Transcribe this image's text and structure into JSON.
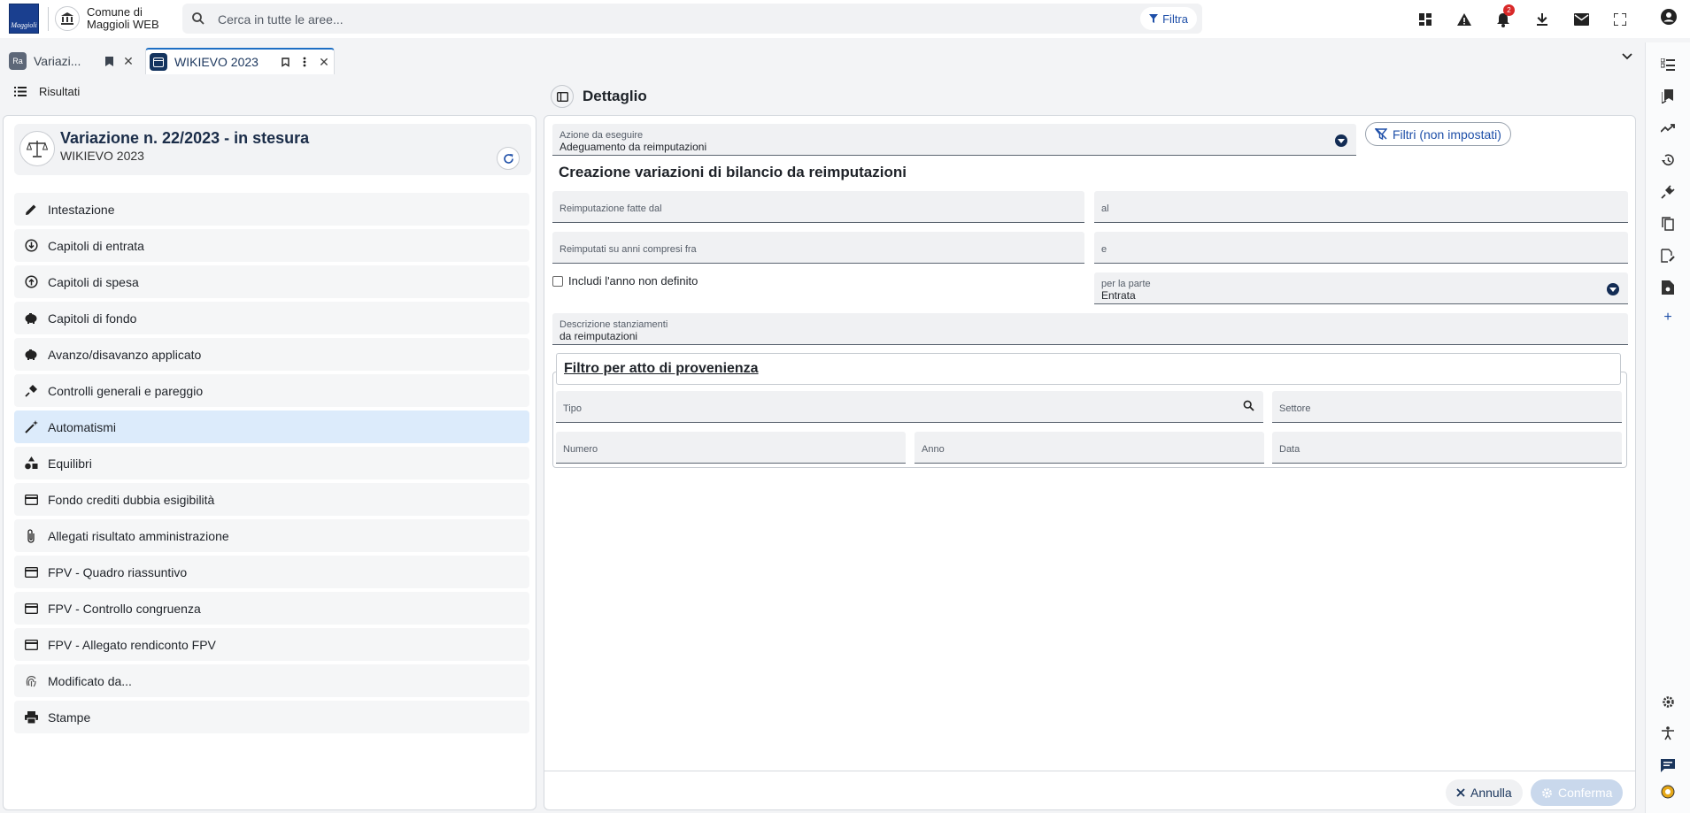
{
  "header": {
    "logo_text": "Maggioli",
    "town_name_line1": "Comune di",
    "town_name_line2": "Maggioli WEB",
    "search_placeholder": "Cerca in tutte le aree...",
    "filter_label": "Filtra",
    "notification_count": "2"
  },
  "tabs": [
    {
      "label": "Variazi...",
      "icon_text": "Ra"
    },
    {
      "label": "WIKIEVO 2023"
    }
  ],
  "left": {
    "header_label": "Risultati",
    "card_title": "Variazione n. 22/2023 - in stesura",
    "card_subtitle": "WIKIEVO 2023",
    "menu": [
      {
        "label": "Intestazione",
        "icon": "pencil-icon"
      },
      {
        "label": "Capitoli di entrata",
        "icon": "arrow-down-circle-icon"
      },
      {
        "label": "Capitoli di spesa",
        "icon": "arrow-up-circle-icon"
      },
      {
        "label": "Capitoli di fondo",
        "icon": "piggy-bank-icon"
      },
      {
        "label": "Avanzo/disavanzo applicato",
        "icon": "piggy-bank-icon"
      },
      {
        "label": "Controlli generali e pareggio",
        "icon": "plug-icon"
      },
      {
        "label": "Automatismi",
        "icon": "magic-wand-icon",
        "active": true
      },
      {
        "label": "Equilibri",
        "icon": "shapes-icon"
      },
      {
        "label": "Fondo crediti dubbia esigibilità",
        "icon": "card-icon"
      },
      {
        "label": "Allegati risultato amministrazione",
        "icon": "paperclip-icon"
      },
      {
        "label": "FPV - Quadro riassuntivo",
        "icon": "card-icon"
      },
      {
        "label": "FPV - Controllo congruenza",
        "icon": "card-icon"
      },
      {
        "label": "FPV - Allegato rendiconto FPV",
        "icon": "card-icon"
      },
      {
        "label": "Modificato da...",
        "icon": "fingerprint-icon"
      },
      {
        "label": "Stampe",
        "icon": "printer-icon"
      }
    ]
  },
  "detail": {
    "header_title": "Dettaglio",
    "azione_label": "Azione da eseguire",
    "azione_value": "Adeguamento da reimputazioni",
    "filtri_label": "Filtri (non impostati)",
    "section_title": "Creazione variazioni di bilancio da reimputazioni",
    "reimp_dal_label": "Reimputazione fatte dal",
    "al_label": "al",
    "anni_fra_label": "Reimputati su anni compresi fra",
    "e_label": "e",
    "includi_label": "Includi l'anno non definito",
    "parte_label": "per la parte",
    "parte_value": "Entrata",
    "descr_label": "Descrizione stanziamenti",
    "descr_value": "da reimputazioni",
    "filtro_title": "Filtro per atto di provenienza",
    "tipo_label": "Tipo",
    "settore_label": "Settore",
    "numero_label": "Numero",
    "anno_label": "Anno",
    "data_label": "Data",
    "annulla_label": "Annulla",
    "conferma_label": "Conferma"
  },
  "colors": {
    "accent": "#1e4fa8",
    "active_menu": "#dcebfb",
    "dark_navy": "#132c54"
  }
}
